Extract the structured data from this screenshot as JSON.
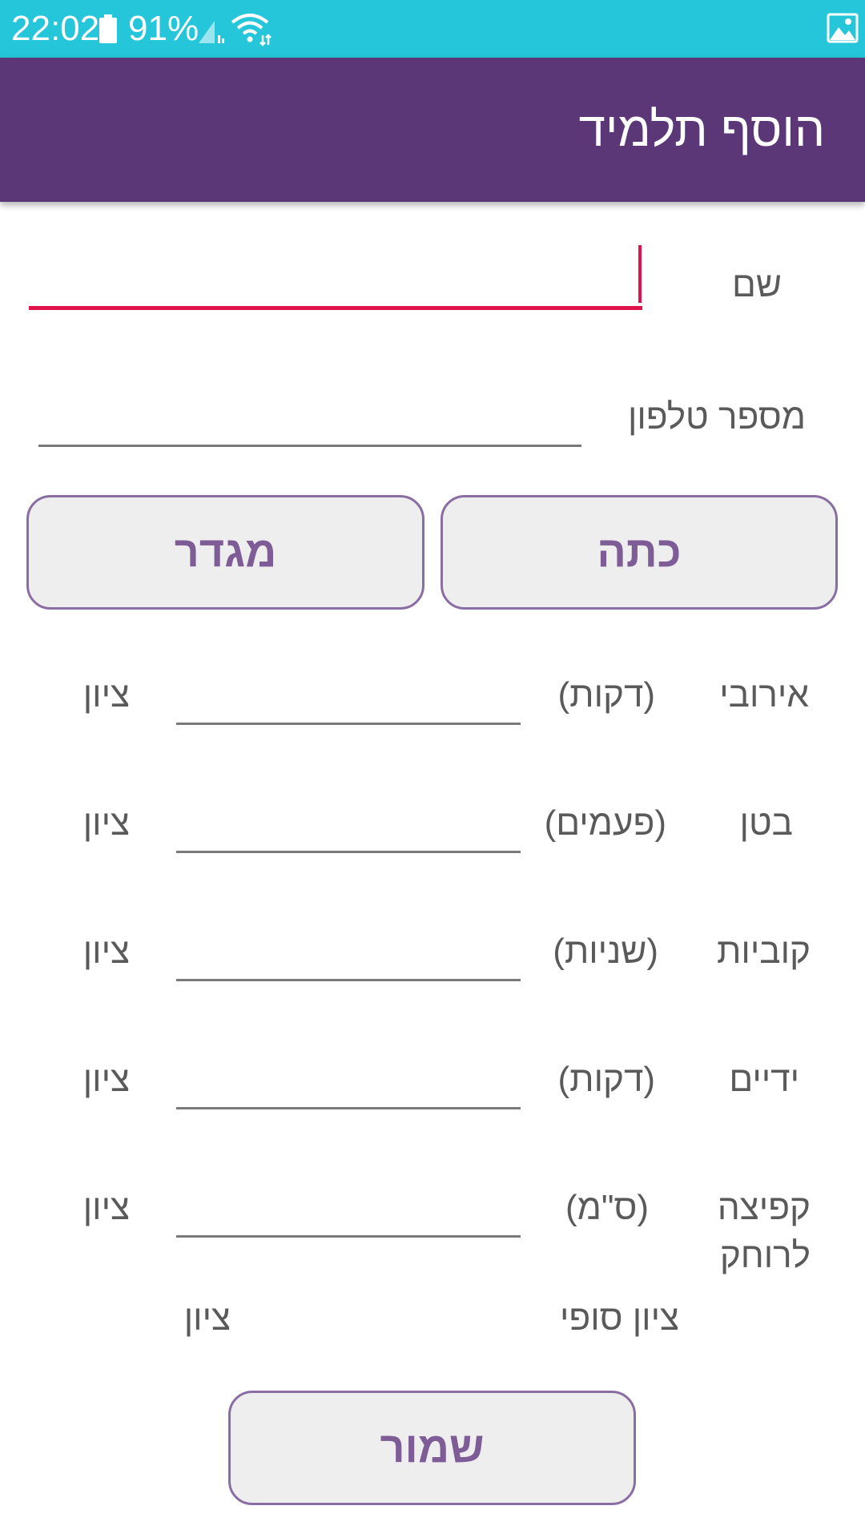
{
  "status_bar": {
    "time": "22:02",
    "battery": "91%",
    "icons": [
      "battery-icon",
      "signal-icon",
      "wifi-icon",
      "image-icon"
    ],
    "background_color": "#26c6da"
  },
  "app_bar": {
    "title": "הוסף תלמיד",
    "background_color": "#5c3777"
  },
  "form": {
    "name_label": "שם",
    "name_value": "",
    "phone_label": "מספר טלפון",
    "phone_value": "",
    "class_button": "כתה",
    "gender_button": "מגדר",
    "grade_label": "ציון",
    "rows": [
      {
        "label": "אירובי",
        "unit": "(דקות)",
        "value": "",
        "grade": "ציון"
      },
      {
        "label": "בטן",
        "unit": "(פעמים)",
        "value": "",
        "grade": "ציון"
      },
      {
        "label": "קוביות",
        "unit": "(שניות)",
        "value": "",
        "grade": "ציון"
      },
      {
        "label": "ידיים",
        "unit": "(דקות)",
        "value": "",
        "grade": "ציון"
      },
      {
        "label": "קפיצה לרוחק",
        "unit": "(ס\"מ)",
        "value": "",
        "grade": "ציון"
      }
    ],
    "final_grade_label": "ציון סופי",
    "final_grade_value": "ציון",
    "save_button": "שמור"
  },
  "colors": {
    "accent": "#e0144c",
    "button_text": "#7e5c96",
    "button_border": "#8a6da2",
    "button_fill": "#eeeeef"
  }
}
